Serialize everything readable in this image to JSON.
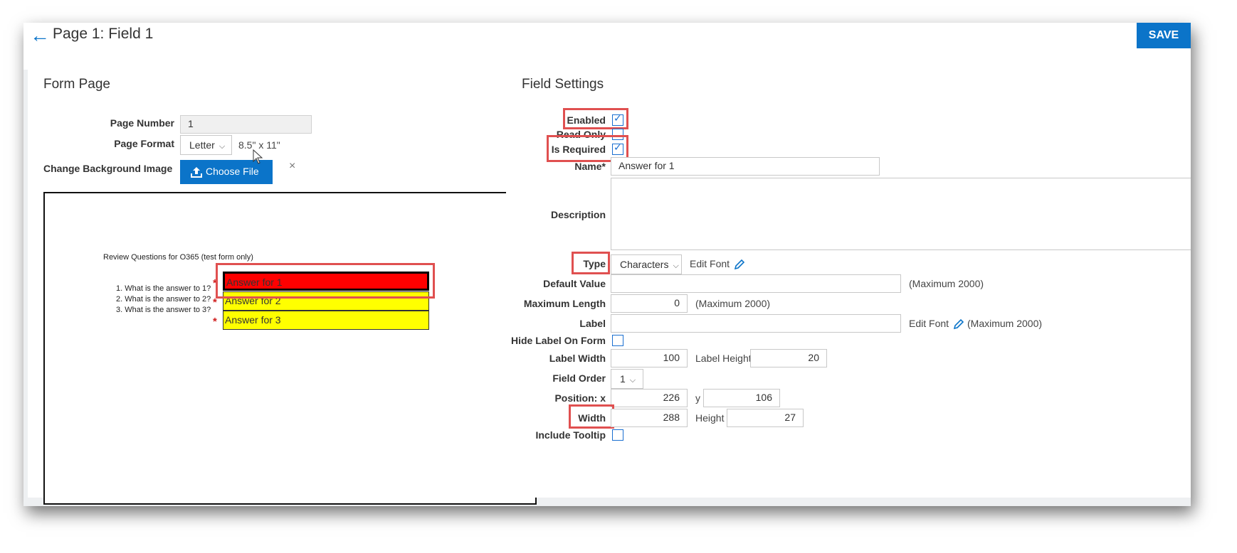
{
  "header": {
    "title": "Page 1: Field 1",
    "save_label": "SAVE"
  },
  "form_page": {
    "title": "Form Page",
    "page_number_label": "Page Number",
    "page_number_value": "1",
    "page_format_label": "Page Format",
    "page_format_value": "Letter",
    "page_size": "8.5\" x 11\"",
    "background_label": "Change Background Image",
    "choose_file_label": "Choose File",
    "clear_symbol": "×",
    "preview": {
      "heading": "Review Questions for O365 (test form only)",
      "questions": [
        "1.  What is the answer to 1?",
        "2.  What is the answer to 2?",
        "3.  What is the answer to 3?"
      ],
      "required_marker": "*",
      "fields": [
        "Answer for 1",
        "Answer for 2",
        "Answer for 3"
      ]
    }
  },
  "field_settings": {
    "title": "Field Settings",
    "enabled_label": "Enabled",
    "read_only_label": "Read Only",
    "is_required_label": "Is Required",
    "name_label": "Name*",
    "name_value": "Answer for 1",
    "description_label": "Description",
    "type_label": "Type",
    "type_value": "Characters",
    "edit_font_label": "Edit Font",
    "default_value_label": "Default Value",
    "max_2000": "(Maximum 2000)",
    "maximum_length_label": "Maximum Length",
    "maximum_length_value": "0",
    "label_label": "Label",
    "hide_label_label": "Hide Label On Form",
    "label_width_label": "Label Width",
    "label_width_value": "100",
    "label_height_label": "Label Height",
    "label_height_value": "20",
    "field_order_label": "Field Order",
    "field_order_value": "1",
    "position_x_label": "Position: x",
    "position_x_value": "226",
    "position_y_label": "y",
    "position_y_value": "106",
    "width_label": "Width",
    "width_value": "288",
    "height_label": "Height",
    "height_value": "27",
    "include_tooltip_label": "Include Tooltip",
    "checks": {
      "enabled": true,
      "read_only": false,
      "is_required": true,
      "hide_label": false,
      "include_tooltip": false
    }
  },
  "colors": {
    "accent": "#0b74c9",
    "highlight": "#e05050",
    "field_fill": "#ffff00",
    "active_field": "#ff0000"
  }
}
